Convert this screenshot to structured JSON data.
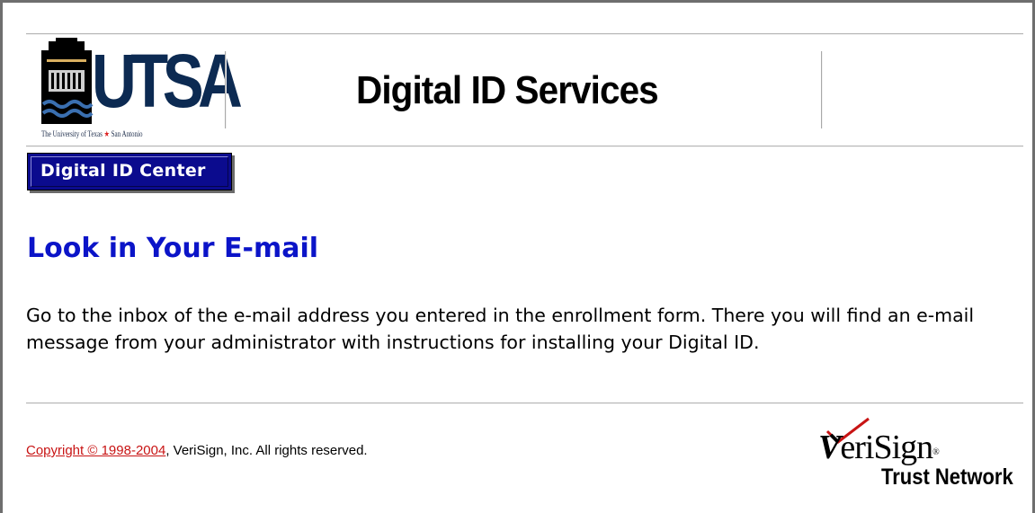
{
  "header": {
    "logo": {
      "text": "UTSA",
      "tagline_left": "The University of Texas",
      "tagline_right": "San Antonio"
    },
    "service_title": "Digital ID Services"
  },
  "nav": {
    "center_button": "Digital ID Center"
  },
  "main": {
    "heading": "Look in Your E-mail",
    "body": "Go to the inbox of the e-mail address you entered in the enrollment form. There you will find an e-mail message from your administrator with instructions for installing your Digital ID."
  },
  "footer": {
    "copyright_link": "Copyright © 1998-2004",
    "copyright_rest": ", VeriSign, Inc. All rights reserved.",
    "brand": {
      "v": "V",
      "rest": "eriSign",
      "tm": "®",
      "network": "Trust Network"
    }
  },
  "colors": {
    "heading": "#0b14c8",
    "badge": "#0b0b8e",
    "link": "#c81414",
    "logo": "#0c2a52"
  }
}
